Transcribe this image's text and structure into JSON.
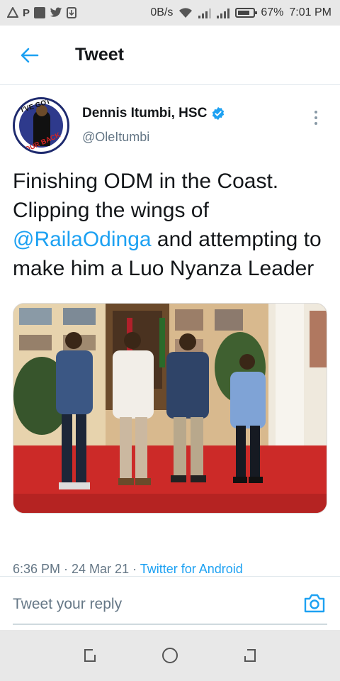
{
  "status_bar": {
    "network_speed": "0B/s",
    "battery_percent": "67%",
    "time": "7:01 PM",
    "left_icons": [
      "alert-icon",
      "p-icon",
      "square-icon",
      "twitter-icon",
      "download-icon"
    ]
  },
  "header": {
    "title": "Tweet",
    "back_icon": "back-arrow-icon"
  },
  "tweet": {
    "author": {
      "display_name": "Dennis Itumbi, HSC",
      "handle": "@OleItumbi",
      "verified": true,
      "avatar_text_top": "I'VE GOT",
      "avatar_text_bottom": "YOUR BACK"
    },
    "text_part1": "Finishing ODM in the Coast. Clipping the wings of ",
    "mention": "@RailaOdinga",
    "text_part2": " and attempting to make him a Luo Nyanza Leader",
    "media_icon": "photo-four-men-standing",
    "timestamp": "6:36 PM · 24 Mar 21 · ",
    "source": "Twitter for Android"
  },
  "reply": {
    "placeholder": "Tweet your reply",
    "camera_icon": "camera-icon"
  },
  "nav": {
    "icons": [
      "recents-icon",
      "home-icon",
      "back-icon"
    ]
  },
  "colors": {
    "accent": "#1da1f2",
    "text": "#14171a",
    "secondary": "#657786",
    "system_bar": "#e8e8e8"
  }
}
